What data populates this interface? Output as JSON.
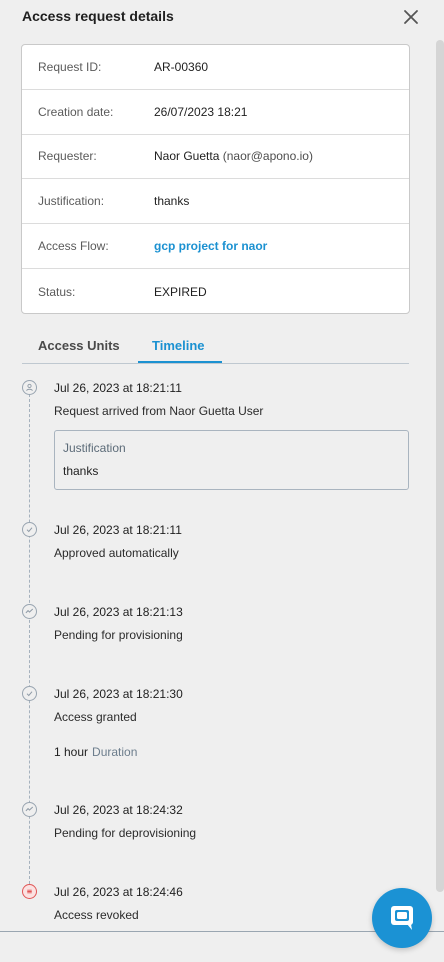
{
  "header": {
    "title": "Access request details"
  },
  "details": [
    {
      "label": "Request ID:",
      "value": "AR-00360",
      "extra": ""
    },
    {
      "label": "Creation date:",
      "value": "26/07/2023 18:21",
      "extra": ""
    },
    {
      "label": "Requester:",
      "value": "Naor Guetta",
      "extra": "(naor@apono.io)"
    },
    {
      "label": "Justification:",
      "value": "thanks",
      "extra": ""
    },
    {
      "label": "Access Flow:",
      "value": "gcp project for naor",
      "extra": ""
    },
    {
      "label": "Status:",
      "value": "EXPIRED",
      "extra": ""
    }
  ],
  "tabs": [
    {
      "label": "Access Units",
      "active": false
    },
    {
      "label": "Timeline",
      "active": true
    }
  ],
  "timeline": [
    {
      "date": "Jul 26, 2023 at 18:21:11",
      "text": "Request arrived from Naor Guetta User",
      "icon": "user-icon"
    },
    {
      "date": "Jul 26, 2023 at 18:21:11",
      "text": "Approved automatically",
      "icon": "check-icon"
    },
    {
      "date": "Jul 26, 2023 at 18:21:13",
      "text": "Pending for provisioning",
      "icon": "activity-icon"
    },
    {
      "date": "Jul 26, 2023 at 18:21:30",
      "text": "Access granted",
      "icon": "check-icon"
    },
    {
      "date": "Jul 26, 2023 at 18:24:32",
      "text": "Pending for deprovisioning",
      "icon": "activity-icon"
    },
    {
      "date": "Jul 26, 2023 at 18:24:46",
      "text": "Access revoked",
      "icon": "revoked-icon"
    }
  ],
  "justification_box": {
    "label": "Justification",
    "value": "thanks"
  },
  "duration": {
    "value": "1 hour",
    "label": "Duration"
  },
  "colors": {
    "accent": "#1b91d1",
    "revoked": "#e05555"
  }
}
